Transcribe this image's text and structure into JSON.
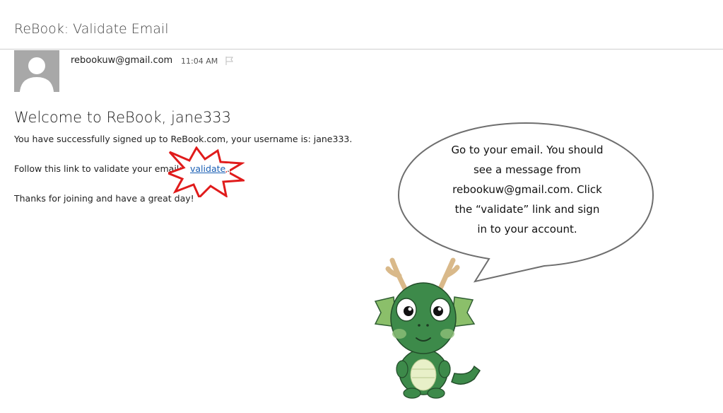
{
  "email": {
    "subject": "ReBook: Validate Email",
    "sender": "rebookuw@gmail.com",
    "time": "11:04 AM",
    "greeting": "Welcome to ReBook, jane333",
    "body_line1": "You have successfully signed up to ReBook.com, your username is: jane333.",
    "body_line2_prefix": "Follow this link to validate your email:",
    "validate_link": "validate",
    "link_suffix": ".",
    "body_line3": "Thanks for joining and have a great day!"
  },
  "callout": {
    "lines": [
      "Go to your email. You should",
      "see a message from",
      "rebookuw@gmail.com. Click",
      "the “validate” link and sign",
      "in to your account."
    ]
  },
  "colors": {
    "link": "#1a5fb4",
    "burst": "#e01b1b",
    "dragon": "#3d8a4a"
  },
  "icons": {
    "avatar": "person-silhouette-icon",
    "flag": "flag-icon"
  }
}
